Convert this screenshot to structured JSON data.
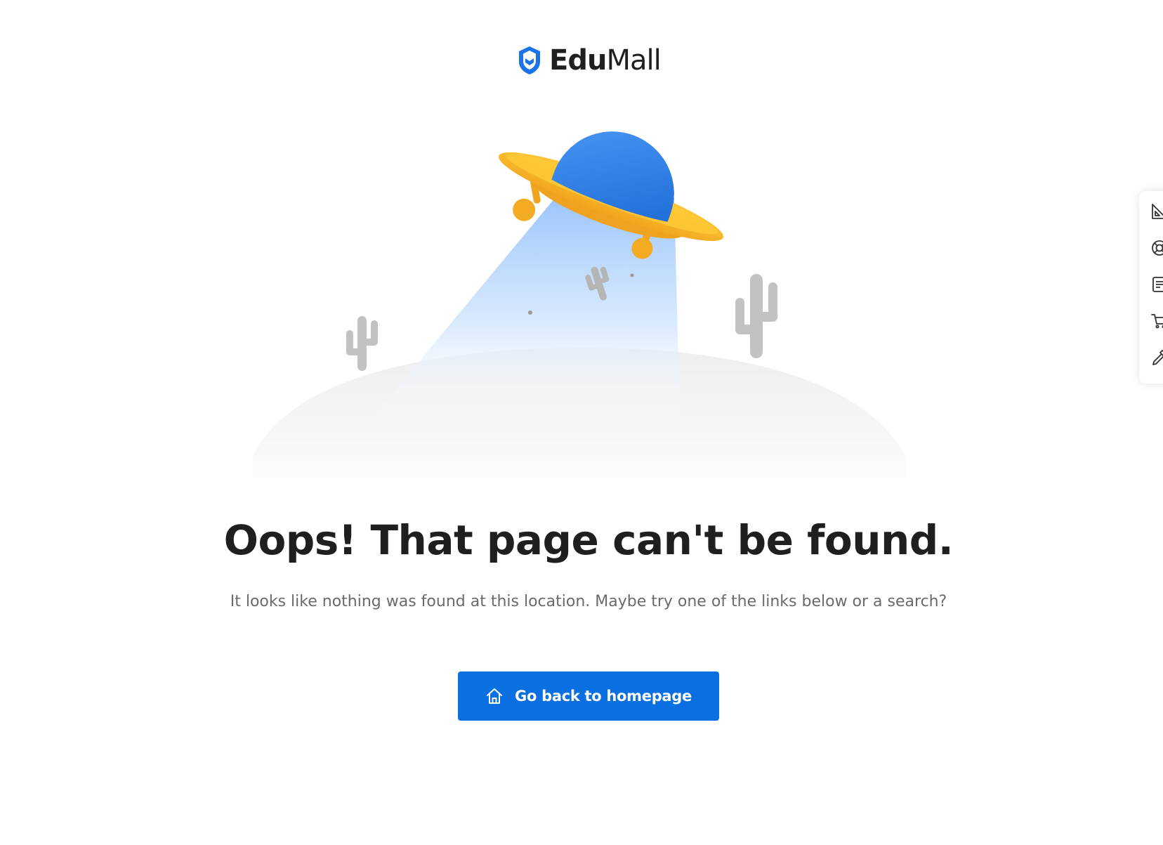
{
  "brand": {
    "name_bold": "Edu",
    "name_regular": "Mall",
    "color": "#1a73e8"
  },
  "error": {
    "headline": "Oops! That page can't be found.",
    "message": "It looks like nothing was found at this location. Maybe try one of the links below or a search?"
  },
  "cta": {
    "label": "Go back to homepage",
    "icon": "home-icon",
    "color": "#0a6fe0"
  },
  "side_toolbar": {
    "items": [
      {
        "icon": "ruler-pencil-icon"
      },
      {
        "icon": "lifebuoy-icon"
      },
      {
        "icon": "document-icon"
      },
      {
        "icon": "cart-icon"
      },
      {
        "icon": "eyedropper-icon"
      }
    ]
  },
  "illustration": {
    "subject": "ufo-abducting-cactus",
    "colors": {
      "dome": "#2f80ed",
      "saucer": "#f6b92b",
      "beam": "#a9cdfb",
      "cactus": "#c4c4c4"
    }
  }
}
